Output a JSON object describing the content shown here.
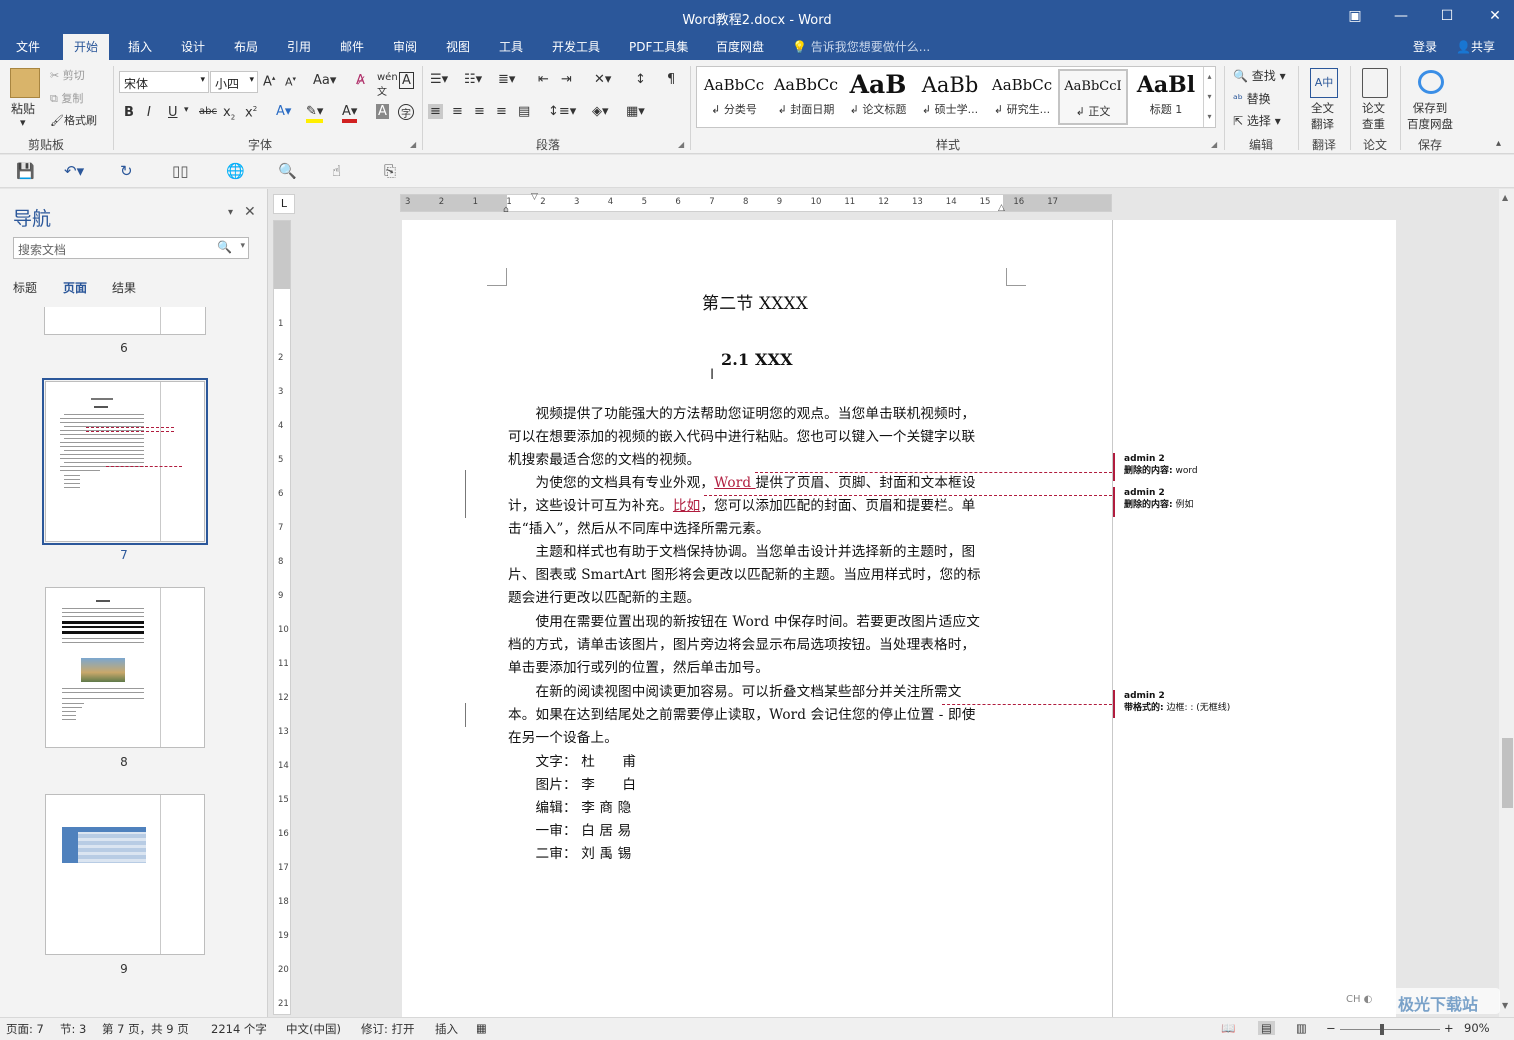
{
  "window": {
    "title": "Word教程2.docx - Word"
  },
  "menu": {
    "tabs": [
      "文件",
      "开始",
      "插入",
      "设计",
      "布局",
      "引用",
      "邮件",
      "审阅",
      "视图",
      "工具",
      "开发工具",
      "PDF工具集",
      "百度网盘"
    ],
    "active": "开始",
    "tell_me": "告诉我您想要做什么...",
    "login": "登录",
    "share": "共享"
  },
  "ribbon": {
    "clipboard": {
      "paste": "粘贴",
      "cut": "剪切",
      "copy": "复制",
      "format_painter": "格式刷",
      "label": "剪贴板"
    },
    "font": {
      "name": "宋体",
      "size": "小四",
      "case_btn": "Aa",
      "label": "字体"
    },
    "paragraph": {
      "label": "段落"
    },
    "styles": {
      "items": [
        {
          "sample": "AaBbCc",
          "name": "↲ 分类号"
        },
        {
          "sample": "AaBbCc",
          "name": "↲ 封面日期"
        },
        {
          "sample": "AaB",
          "name": "↲ 论文标题"
        },
        {
          "sample": "AaBb",
          "name": "↲ 硕士学..."
        },
        {
          "sample": "AaBbCc",
          "name": "↲ 研究生..."
        },
        {
          "sample": "AaBbCcI",
          "name": "↲ 正文"
        },
        {
          "sample": "AaBl",
          "name": "标题 1"
        }
      ],
      "label": "样式"
    },
    "editing": {
      "find": "查找",
      "replace": "替换",
      "select": "选择",
      "label": "编辑"
    },
    "translate": {
      "btn": "全文\n翻译",
      "label": "翻译"
    },
    "paper": {
      "btn": "论文\n查重",
      "label": "论文"
    },
    "save": {
      "btn": "保存到\n百度网盘",
      "label": "保存"
    }
  },
  "nav": {
    "title": "导航",
    "search_placeholder": "搜索文档",
    "tabs": [
      "标题",
      "页面",
      "结果"
    ],
    "active_tab": "页面",
    "pages": [
      "6",
      "7",
      "8",
      "9"
    ],
    "selected_page": "7"
  },
  "ruler": {
    "h_labels": [
      "3",
      "2",
      "1",
      "1",
      "2",
      "3",
      "4",
      "5",
      "6",
      "7",
      "8",
      "9",
      "10",
      "11",
      "12",
      "13",
      "14",
      "15",
      "16",
      "17"
    ],
    "v_labels": [
      "1",
      "2",
      "3",
      "4",
      "5",
      "6",
      "7",
      "8",
      "9",
      "10",
      "11",
      "12",
      "13",
      "14",
      "15",
      "16",
      "17",
      "18",
      "19",
      "20",
      "21"
    ],
    "tab_marker": "L"
  },
  "document": {
    "section_title": "第二节  XXXX",
    "heading": "2.1 XXX",
    "para1": [
      "　　视频提供了功能强大的方法帮助您证明您的观点。当您单击联机视频时，",
      "可以在想要添加的视频的嵌入代码中进行粘贴。您也可以键入一个关键字以联",
      "机搜索最适合您的文档的视频。"
    ],
    "para2_l1_a": "　　为使您的文档具有专业外观，",
    "para2_l1_ins": "Word ",
    "para2_l1_b": "提供了页眉、页脚、封面和文本框设",
    "para2_l2_a": "计，这些设计可互为补充。",
    "para2_l2_ins": "比如",
    "para2_l2_b": "，您可以添加匹配的封面、页眉和提要栏。单",
    "para2_l3": "击“插入”，然后从不同库中选择所需元素。",
    "para3": [
      "　　主题和样式也有助于文档保持协调。当您单击设计并选择新的主题时，图",
      "片、图表或 SmartArt 图形将会更改以匹配新的主题。当应用样式时，您的标",
      "题会进行更改以匹配新的主题。"
    ],
    "para4": [
      "　　使用在需要位置出现的新按钮在 Word 中保存时间。若要更改图片适应文",
      "档的方式，请单击该图片，图片旁边将会显示布局选项按钮。当处理表格时，",
      "单击要添加行或列的位置，然后单击加号。"
    ],
    "para5": [
      "　　在新的阅读视图中阅读更加容易。可以折叠文档某些部分并关注所需文",
      "本。如果在达到结尾处之前需要停止读取，Word 会记住您的停止位置 - 即使",
      "在另一个设备上。"
    ],
    "credits": [
      "　　文字： 杜　　甫",
      "　　图片： 李　　白",
      "　　编辑： 李 商 隐",
      "　　一审： 白 居 易",
      "　　二审： 刘 禹 锡"
    ]
  },
  "comments": [
    {
      "author": "admin 2",
      "label": "删除的内容:",
      "value": " word"
    },
    {
      "author": "admin 2",
      "label": "删除的内容:",
      "value": " 例如"
    },
    {
      "author": "admin 2",
      "label": "带格式的:",
      "value": " 边框: : (无框线)"
    }
  ],
  "status": {
    "page": "页面: 7",
    "section": "节: 3",
    "page_of": "第 7 页，共 9 页",
    "words": "2214 个字",
    "language": "中文(中国)",
    "track": "修订: 打开",
    "mode": "插入",
    "zoom": "90%"
  },
  "watermark": "极光下载站"
}
